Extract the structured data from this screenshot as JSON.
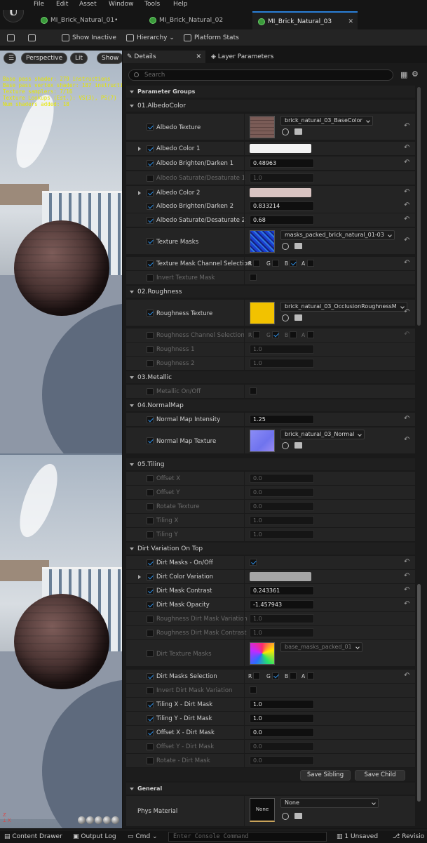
{
  "menu": [
    "File",
    "Edit",
    "Asset",
    "Window",
    "Tools",
    "Help"
  ],
  "tabs": [
    "MI_Brick_Natural_01•",
    "MI_Brick_Natural_02",
    "MI_Brick_Natural_03"
  ],
  "toolbar": {
    "show_inactive": "Show Inactive",
    "hierarchy": "Hierarchy",
    "platform_stats": "Platform Stats"
  },
  "viewport": {
    "perspective": "Perspective",
    "lit": "Lit",
    "show": "Show",
    "stats": [
      "Base pass shader: 279 instructions",
      "Base pass vertex shader: 187 instructions",
      "Texture samplers: 7/16",
      "Texture Lookups (Est.): VS(3), PS(7)",
      "Num shaders added: 18"
    ]
  },
  "details": {
    "tab_details": "Details",
    "tab_layers": "Layer Parameters",
    "search_placeholder": "Search",
    "parameter_groups": "Parameter Groups",
    "albedo": {
      "title": "01.AlbedoColor",
      "albedo_texture": "Albedo Texture",
      "albedo_texture_value": "brick_natural_03_BaseColor",
      "albedo_color_1": "Albedo Color 1",
      "bd1": "Albedo Brighten/Darken 1",
      "bd1_value": "0.48963",
      "sd1": "Albedo Saturate/Desaturate 1",
      "sd1_value": "1.0",
      "albedo_color_2": "Albedo Color 2",
      "bd2": "Albedo Brighten/Darken 2",
      "bd2_value": "0.833214",
      "sd2": "Albedo Saturate/Desaturate 2",
      "sd2_value": "0.68",
      "texture_masks": "Texture Masks",
      "texture_masks_value": "masks_packed_brick_natural_01-03",
      "mask_channel": "Texture Mask Channel Selection",
      "invert": "Invert Texture Mask"
    },
    "channels": {
      "r": "R",
      "g": "G",
      "b": "B",
      "a": "A"
    },
    "roughness": {
      "title": "02.Roughness",
      "texture": "Roughness Texture",
      "texture_value": "brick_natural_03_OcclusionRoughnessM",
      "channel": "Roughness Channel Selection",
      "r1": "Roughness 1",
      "r1_value": "1.0",
      "r2": "Roughness 2",
      "r2_value": "1.0"
    },
    "metallic": {
      "title": "03.Metallic",
      "onoff": "Metallic On/Off"
    },
    "normal": {
      "title": "04.NormalMap",
      "intensity": "Normal Map Intensity",
      "intensity_value": "1.25",
      "texture": "Normal Map Texture",
      "texture_value": "brick_natural_03_Normal"
    },
    "tiling": {
      "title": "05.Tiling",
      "offx": "Offset X",
      "offx_value": "0.0",
      "offy": "Offset Y",
      "offy_value": "0.0",
      "rot": "Rotate Texture",
      "rot_value": "0.0",
      "tx": "Tiling X",
      "tx_value": "1.0",
      "ty": "Tiling Y",
      "ty_value": "1.0"
    },
    "dirt": {
      "title": "Dirt Variation On Top",
      "masks_onoff": "Dirt Masks - On/Off",
      "color_var": "Dirt Color Variation",
      "contrast": "Dirt Mask Contrast",
      "contrast_value": "0.243361",
      "opacity": "Dirt Mask Opacity",
      "opacity_value": "-1.457943",
      "rough_var": "Roughness Dirt Mask Variation",
      "rough_var_value": "1.0",
      "rough_con": "Roughness Dirt Mask Contrast",
      "rough_con_value": "1.0",
      "tex_masks": "Dirt Texture Masks",
      "tex_masks_value": "base_masks_packed_01",
      "selection": "Dirt Masks Selection",
      "invert": "Invert Dirt Mask Variation",
      "tilx": "Tiling X - Dirt Mask",
      "tilx_value": "1.0",
      "tily": "Tiling Y - Dirt Mask",
      "tily_value": "1.0",
      "offx": "Offset X - Dirt Mask",
      "offx_value": "0.0",
      "offy": "Offset Y - Dirt Mask",
      "offy_value": "0.0",
      "rot": "Rotate - Dirt Mask",
      "rot_value": "0.0"
    },
    "save_sibling": "Save Sibling",
    "save_child": "Save Child",
    "general": {
      "title": "General",
      "phys": "Phys Material",
      "phys_value": "None",
      "none_thumb": "None"
    }
  },
  "status": {
    "content_drawer": "Content Drawer",
    "output_log": "Output Log",
    "cmd": "Cmd",
    "console_placeholder": "Enter Console Command",
    "unsaved": "1 Unsaved",
    "revision": "Revisio"
  },
  "colors": {
    "albedo_color_1": "#f2f2f2",
    "albedo_color_2": "#d9c4c2",
    "dirt_color": "#a6a6a6",
    "accent": "#2d8fe6"
  }
}
